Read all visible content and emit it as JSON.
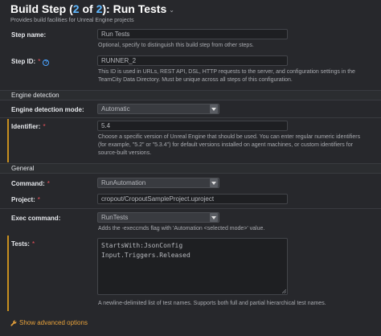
{
  "header": {
    "title_prefix": "Build Step (",
    "step_current": "2",
    "title_of": " of ",
    "step_total": "2",
    "title_suffix": "): Run Tests",
    "subtitle": "Provides build facilities for Unreal Engine projects"
  },
  "step_name": {
    "label": "Step name:",
    "value": "Run Tests",
    "hint": "Optional, specify to distinguish this build step from other steps."
  },
  "step_id": {
    "label": "Step ID:",
    "required_mark": "*",
    "value": "RUNNER_2",
    "hint_line1": "This ID is used in URLs, REST API, DSL, HTTP requests to the server, and configuration settings in the",
    "hint_line2": "TeamCity Data Directory. Must be unique across all steps of this configuration."
  },
  "engine_section": {
    "title": "Engine detection"
  },
  "engine_mode": {
    "label": "Engine detection mode:",
    "selected": "Automatic"
  },
  "identifier": {
    "label": "Identifier:",
    "required_mark": "*",
    "value": "5.4",
    "hint_line1": "Choose a specific version of Unreal Engine that should be used. You can enter regular numeric identifiers",
    "hint_line2": "(for example, \"5.2\" or \"5.3.4\") for default versions installed on agent machines, or custom identifiers for",
    "hint_line3": "source-built versions."
  },
  "general_section": {
    "title": "General"
  },
  "command": {
    "label": "Command:",
    "required_mark": "*",
    "selected": "RunAutomation"
  },
  "project": {
    "label": "Project:",
    "required_mark": "*",
    "value": "cropout/CropoutSampleProject.uproject"
  },
  "exec_command": {
    "label": "Exec command:",
    "selected": "RunTests",
    "hint": "Adds the -execcmds flag with 'Automation <selected mode>' value."
  },
  "tests": {
    "label": "Tests:",
    "required_mark": "*",
    "line1": "StartsWith:JsonConfig",
    "line2": "Input.Triggers.Released",
    "hint": "A newline-delimited list of test names. Supports both full and partial hierarchical test names."
  },
  "advanced": {
    "label": "Show advanced options"
  },
  "icons": {
    "help": "help-circle-icon",
    "dropdown": "chevron-down-icon",
    "settings": "wrench-icon",
    "resize": "resize-grip-icon"
  },
  "colors": {
    "background": "#27282c",
    "accent_blue": "#5fb8ff",
    "required_red": "#f0525b",
    "warning_bar": "#c78f1f",
    "advanced_link": "#e8a23b"
  }
}
